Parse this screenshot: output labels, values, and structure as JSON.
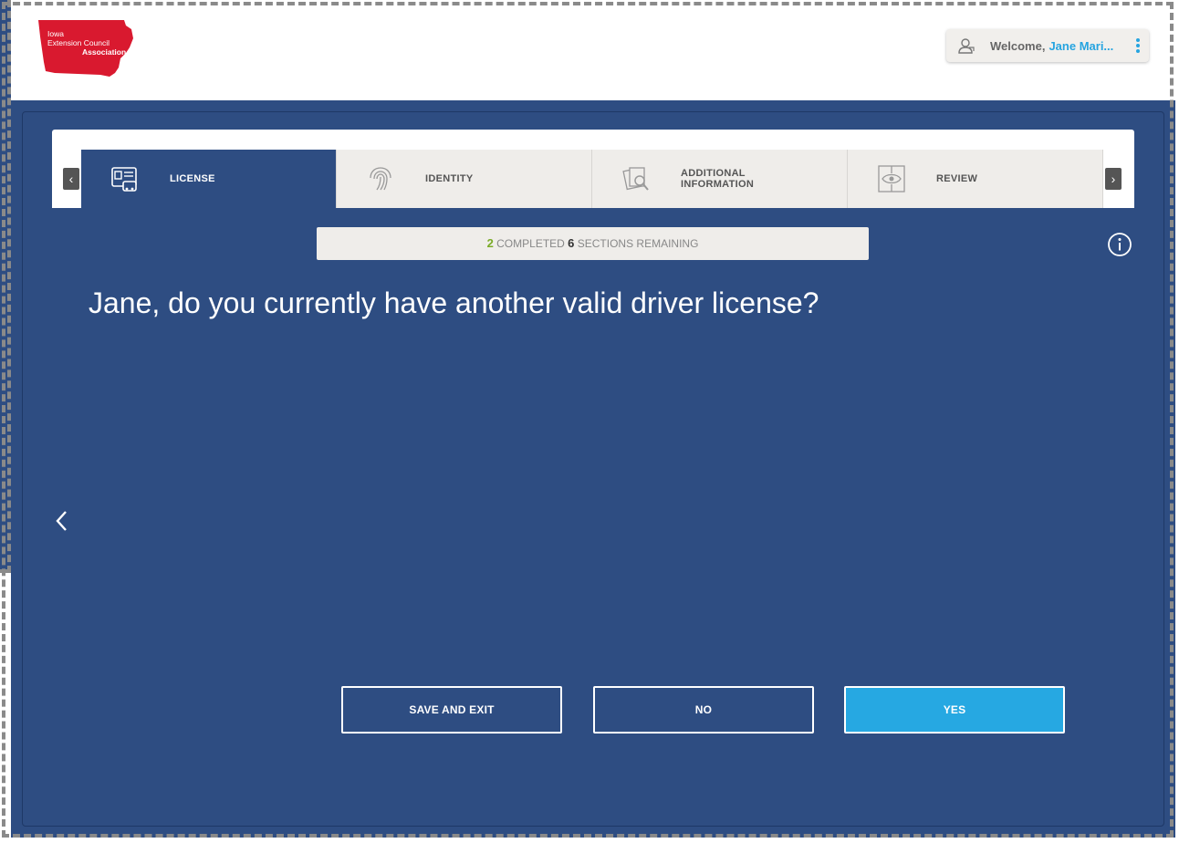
{
  "header": {
    "logo": {
      "line1": "Iowa",
      "line2": "Extension Council",
      "line3": "Association",
      "color": "#d9192f"
    },
    "user": {
      "welcome": "Welcome,",
      "name": "Jane Mari...",
      "accent": "#26a4e0"
    }
  },
  "tabs": [
    {
      "label": "LICENSE",
      "icon": "license-card-icon",
      "active": true
    },
    {
      "label": "IDENTITY",
      "icon": "fingerprint-icon",
      "active": false
    },
    {
      "label_line1": "ADDITIONAL",
      "label_line2": "INFORMATION",
      "icon": "documents-search-icon",
      "active": false
    },
    {
      "label": "REVIEW",
      "icon": "eye-review-icon",
      "active": false
    }
  ],
  "progress": {
    "completed_count": "2",
    "completed_label": "COMPLETED",
    "remaining_count": "6",
    "remaining_label": "SECTIONS REMAINING"
  },
  "question": "Jane, do you currently have another valid driver license?",
  "buttons": {
    "save_exit": "SAVE AND EXIT",
    "no": "NO",
    "yes": "YES"
  },
  "colors": {
    "background": "#2e4d82",
    "primary_button": "#26a8e2",
    "progress_done": "#7aab27"
  }
}
